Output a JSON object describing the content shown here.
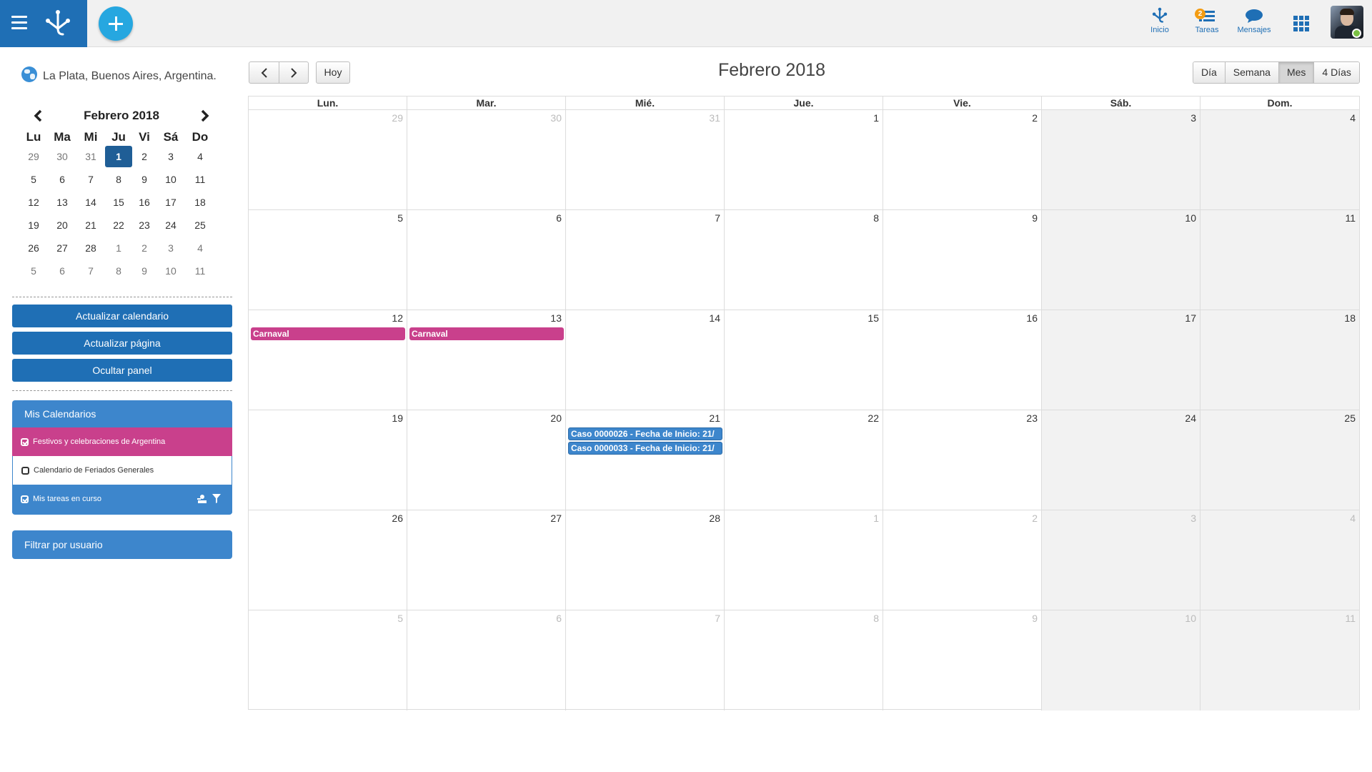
{
  "topbar": {
    "actions": [
      {
        "label": "Inicio"
      },
      {
        "label": "Tareas",
        "badge": "2"
      },
      {
        "label": "Mensajes"
      }
    ]
  },
  "sidebar": {
    "location": "La Plata, Buenos Aires, Argentina.",
    "mini_calendar": {
      "title": "Febrero 2018",
      "weekdays": [
        "Lu",
        "Ma",
        "Mi",
        "Ju",
        "Vi",
        "Sá",
        "Do"
      ],
      "weeks": [
        [
          "29",
          "30",
          "31",
          "1",
          "2",
          "3",
          "4"
        ],
        [
          "5",
          "6",
          "7",
          "8",
          "9",
          "10",
          "11"
        ],
        [
          "12",
          "13",
          "14",
          "15",
          "16",
          "17",
          "18"
        ],
        [
          "19",
          "20",
          "21",
          "22",
          "23",
          "24",
          "25"
        ],
        [
          "26",
          "27",
          "28",
          "1",
          "2",
          "3",
          "4"
        ],
        [
          "5",
          "6",
          "7",
          "8",
          "9",
          "10",
          "11"
        ]
      ],
      "selected": "1"
    },
    "buttons": {
      "refresh_calendar": "Actualizar calendario",
      "refresh_page": "Actualizar página",
      "hide_panel": "Ocultar panel"
    },
    "my_calendars": {
      "title": "Mis Calendarios",
      "items": [
        {
          "label": "Festivos y celebraciones de Argentina",
          "checked": true
        },
        {
          "label": "Calendario de Feriados Generales",
          "checked": false
        },
        {
          "label": "Mis tareas en curso",
          "checked": true
        }
      ]
    },
    "filter_by_user": "Filtrar por usuario"
  },
  "toolbar": {
    "today": "Hoy",
    "title": "Febrero 2018",
    "views": [
      "Día",
      "Semana",
      "Mes",
      "4 Días"
    ],
    "active_view": "Mes"
  },
  "calendar": {
    "weekdays": [
      "Lun.",
      "Mar.",
      "Mié.",
      "Jue.",
      "Vie.",
      "Sáb.",
      "Dom."
    ],
    "weeks": [
      [
        "29",
        "30",
        "31",
        "1",
        "2",
        "3",
        "4"
      ],
      [
        "5",
        "6",
        "7",
        "8",
        "9",
        "10",
        "11"
      ],
      [
        "12",
        "13",
        "14",
        "15",
        "16",
        "17",
        "18"
      ],
      [
        "19",
        "20",
        "21",
        "22",
        "23",
        "24",
        "25"
      ],
      [
        "26",
        "27",
        "28",
        "1",
        "2",
        "3",
        "4"
      ],
      [
        "5",
        "6",
        "7",
        "8",
        "9",
        "10",
        "11"
      ]
    ],
    "events": [
      {
        "week": 2,
        "day": 0,
        "slot": 0,
        "title": "Carnaval",
        "color": "#c9408c"
      },
      {
        "week": 2,
        "day": 1,
        "slot": 0,
        "title": "Carnaval",
        "color": "#c9408c"
      },
      {
        "week": 3,
        "day": 2,
        "slot": 0,
        "title": "Caso 0000026 - Fecha de Inicio: 21/",
        "color": "#3d86cc"
      },
      {
        "week": 3,
        "day": 2,
        "slot": 1,
        "title": "Caso 0000033 - Fecha de Inicio: 21/",
        "color": "#3d86cc"
      }
    ]
  },
  "colors": {
    "brand": "#1f6fb5",
    "holiday": "#c9408c",
    "tasks": "#3d86cc"
  }
}
